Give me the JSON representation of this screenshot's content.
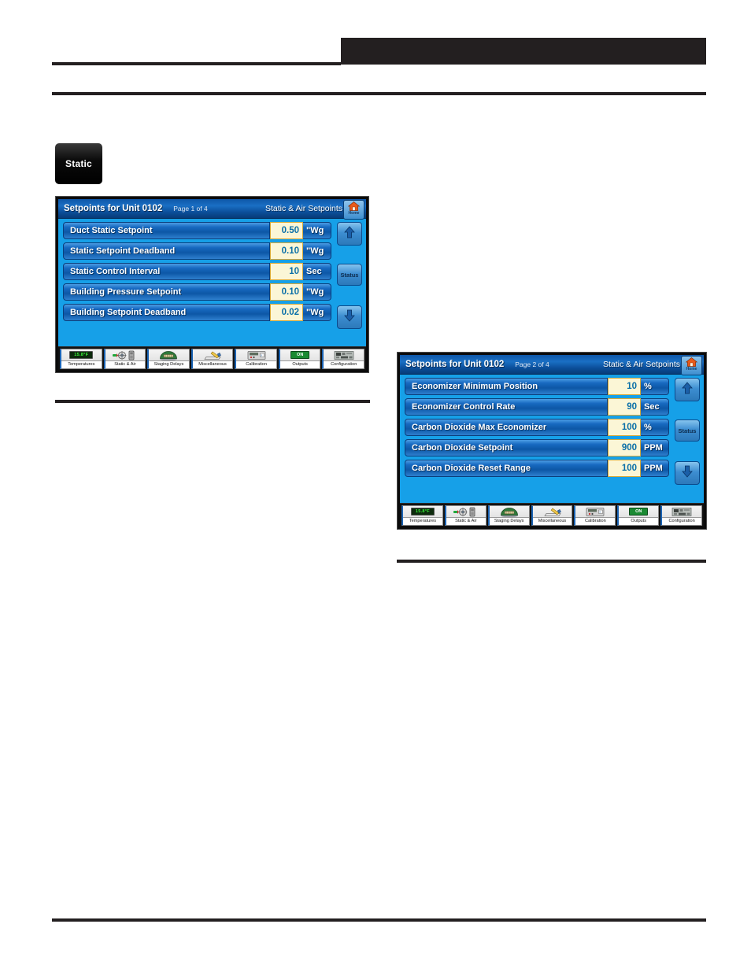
{
  "page": {
    "static_chip_label": "Static",
    "accent_blue": "#16a0e8",
    "header_bar_color": "#231f20",
    "value_box_color": "#fbf6d6",
    "value_text_color": "#0a6fa8"
  },
  "panels": [
    {
      "title": "Setpoints for Unit 0102",
      "page_label": "Page 1 of 4",
      "section": "Static & Air Setpoints",
      "home_label": "Home",
      "status_label": "Status",
      "up_icon": "arrow-up-icon",
      "down_icon": "arrow-down-icon",
      "home_icon": "home-icon",
      "rows": [
        {
          "label": "Duct Static Setpoint",
          "value": "0.50",
          "unit": "\"Wg"
        },
        {
          "label": "Static Setpoint Deadband",
          "value": "0.10",
          "unit": "\"Wg"
        },
        {
          "label": "Static Control Interval",
          "value": "10",
          "unit": "Sec"
        },
        {
          "label": "Building Pressure Setpoint",
          "value": "0.10",
          "unit": "\"Wg"
        },
        {
          "label": "Building Setpoint Deadband",
          "value": "0.02",
          "unit": "\"Wg"
        }
      ],
      "nav": [
        {
          "label": "Temperatures",
          "icon": "thermometer-display-icon",
          "readout": "15.8°F"
        },
        {
          "label": "Static & Air",
          "icon": "static-air-icon"
        },
        {
          "label": "Staging Delays",
          "icon": "staging-delays-icon"
        },
        {
          "label": "Miscellaneous",
          "icon": "miscellaneous-pencil-icon"
        },
        {
          "label": "Calibration",
          "icon": "calibration-meter-icon"
        },
        {
          "label": "Outputs",
          "icon": "outputs-icon",
          "readout": "ON"
        },
        {
          "label": "Configuration",
          "icon": "configuration-board-icon"
        }
      ]
    },
    {
      "title": "Setpoints for Unit 0102",
      "page_label": "Page 2 of 4",
      "section": "Static & Air Setpoints",
      "home_label": "Home",
      "status_label": "Status",
      "up_icon": "arrow-up-icon",
      "down_icon": "arrow-down-icon",
      "home_icon": "home-icon",
      "rows": [
        {
          "label": "Economizer Minimum Position",
          "value": "10",
          "unit": "%"
        },
        {
          "label": "Economizer Control Rate",
          "value": "90",
          "unit": "Sec"
        },
        {
          "label": "Carbon Dioxide Max Economizer",
          "value": "100",
          "unit": "%"
        },
        {
          "label": "Carbon Dioxide Setpoint",
          "value": "900",
          "unit": "PPM"
        },
        {
          "label": "Carbon Dioxide Reset Range",
          "value": "100",
          "unit": "PPM"
        }
      ],
      "nav": [
        {
          "label": "Temperatures",
          "icon": "thermometer-display-icon",
          "readout": "15.8°F"
        },
        {
          "label": "Static & Air",
          "icon": "static-air-icon"
        },
        {
          "label": "Staging Delays",
          "icon": "staging-delays-icon"
        },
        {
          "label": "Miscellaneous",
          "icon": "miscellaneous-pencil-icon"
        },
        {
          "label": "Calibration",
          "icon": "calibration-meter-icon"
        },
        {
          "label": "Outputs",
          "icon": "outputs-icon",
          "readout": "ON"
        },
        {
          "label": "Configuration",
          "icon": "configuration-board-icon"
        }
      ]
    }
  ]
}
